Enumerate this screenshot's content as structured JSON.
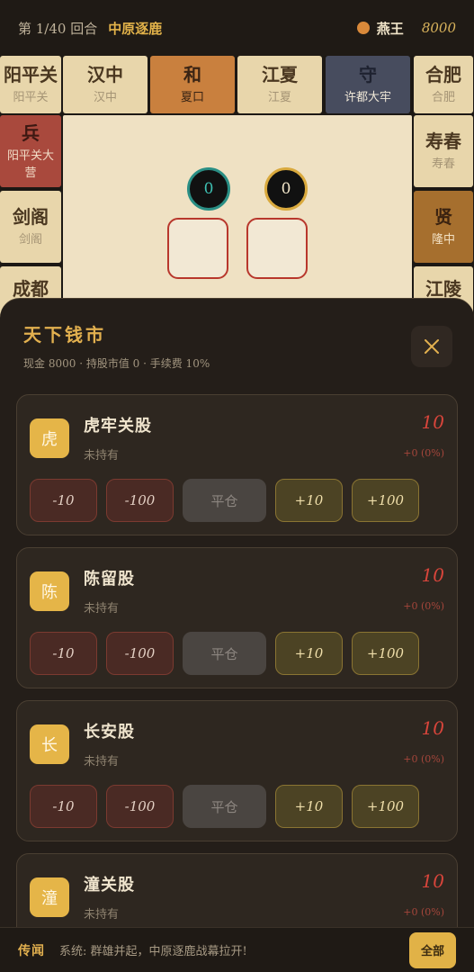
{
  "topbar": {
    "round": "第 1/40 回合",
    "region": "中原逐鹿",
    "player_name": "燕王",
    "player_cash": "8000"
  },
  "board": {
    "top": [
      {
        "name": "阳平关",
        "sub": "阳平关",
        "style": "plain"
      },
      {
        "name": "汉中",
        "sub": "汉中",
        "style": "plain"
      },
      {
        "name": "和",
        "sub": "夏口",
        "style": "orange"
      },
      {
        "name": "江夏",
        "sub": "江夏",
        "style": "plain"
      },
      {
        "name": "守",
        "sub": "许都大牢",
        "style": "blue"
      },
      {
        "name": "合肥",
        "sub": "合肥",
        "style": "plain"
      }
    ],
    "left": [
      {
        "name": "兵",
        "sub": "阳平关大营",
        "style": "red"
      },
      {
        "name": "剑阁",
        "sub": "剑阁",
        "style": "plain"
      },
      {
        "name": "成都",
        "sub": "",
        "style": "plain"
      }
    ],
    "right": [
      {
        "name": "寿春",
        "sub": "寿春",
        "style": "plain"
      },
      {
        "name": "贤",
        "sub": "隆中",
        "style": "brown"
      },
      {
        "name": "江陵",
        "sub": "",
        "style": "plain"
      }
    ],
    "dice": [
      "0",
      "0"
    ]
  },
  "panel": {
    "title": "天下钱市",
    "cash_label": "现金 8000",
    "holdings_label": "· 持股市值 0",
    "fee_label": "· 手续费 10%",
    "buttons": {
      "sell10": "-10",
      "sell100": "-100",
      "flat": "平仓",
      "buy10": "+10",
      "buy100": "+100"
    },
    "stocks": [
      {
        "badge": "虎",
        "name": "虎牢关股",
        "held": "未持有",
        "price": "10",
        "change": "+0 (0%)"
      },
      {
        "badge": "陈",
        "name": "陈留股",
        "held": "未持有",
        "price": "10",
        "change": "+0 (0%)"
      },
      {
        "badge": "长",
        "name": "长安股",
        "held": "未持有",
        "price": "10",
        "change": "+0 (0%)"
      },
      {
        "badge": "潼",
        "name": "潼关股",
        "held": "未持有",
        "price": "10",
        "change": "+0 (0%)"
      }
    ]
  },
  "news": {
    "label": "传闻",
    "text": "系统: 群雄并起，中原逐鹿战幕拉开!",
    "button": "全部"
  },
  "colors": {
    "accent": "#e2b04f",
    "price": "#d8453b",
    "badge": "#e5b548"
  }
}
